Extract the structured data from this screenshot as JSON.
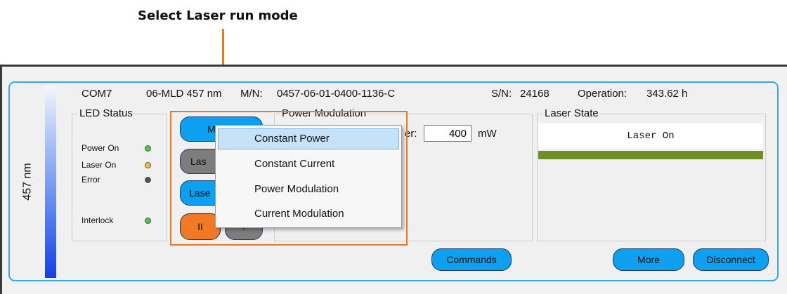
{
  "caption": "Select Laser run mode",
  "panel": {
    "wavelength_label": "457 nm",
    "port": "COM7",
    "model": "06-MLD 457 nm",
    "mn_label": "M/N:",
    "mn_value": "0457-06-01-0400-1136-C",
    "sn_label": "S/N:",
    "sn_value": "24168",
    "operation_label": "Operation:",
    "operation_value": "343.62 h"
  },
  "led_status": {
    "title": "LED Status",
    "items": [
      {
        "label": "Power On",
        "color": "#3cd23c"
      },
      {
        "label": "Laser On",
        "color": "#f2c230"
      },
      {
        "label": "Error",
        "color": "#505050"
      },
      {
        "label": "Interlock",
        "color": "#3cd23c"
      }
    ]
  },
  "controls": {
    "mode_button": "M",
    "laser_button_1": "Las",
    "laser_button_2": "Lase",
    "pause_button": "II",
    "play_button": "›"
  },
  "power_modulation": {
    "title": "Power Modulation",
    "field_label_fragment": "er:",
    "power_value": "400",
    "unit": "mW"
  },
  "run_mode_menu": {
    "items": [
      "Constant Power",
      "Constant Current",
      "Power Modulation",
      "Current Modulation"
    ],
    "selected": "Constant Power"
  },
  "laser_state": {
    "title": "Laser State",
    "status": "Laser On",
    "bar_color": "#6f8f22"
  },
  "buttons": {
    "commands": "Commands",
    "more": "More",
    "disconnect": "Disconnect"
  }
}
